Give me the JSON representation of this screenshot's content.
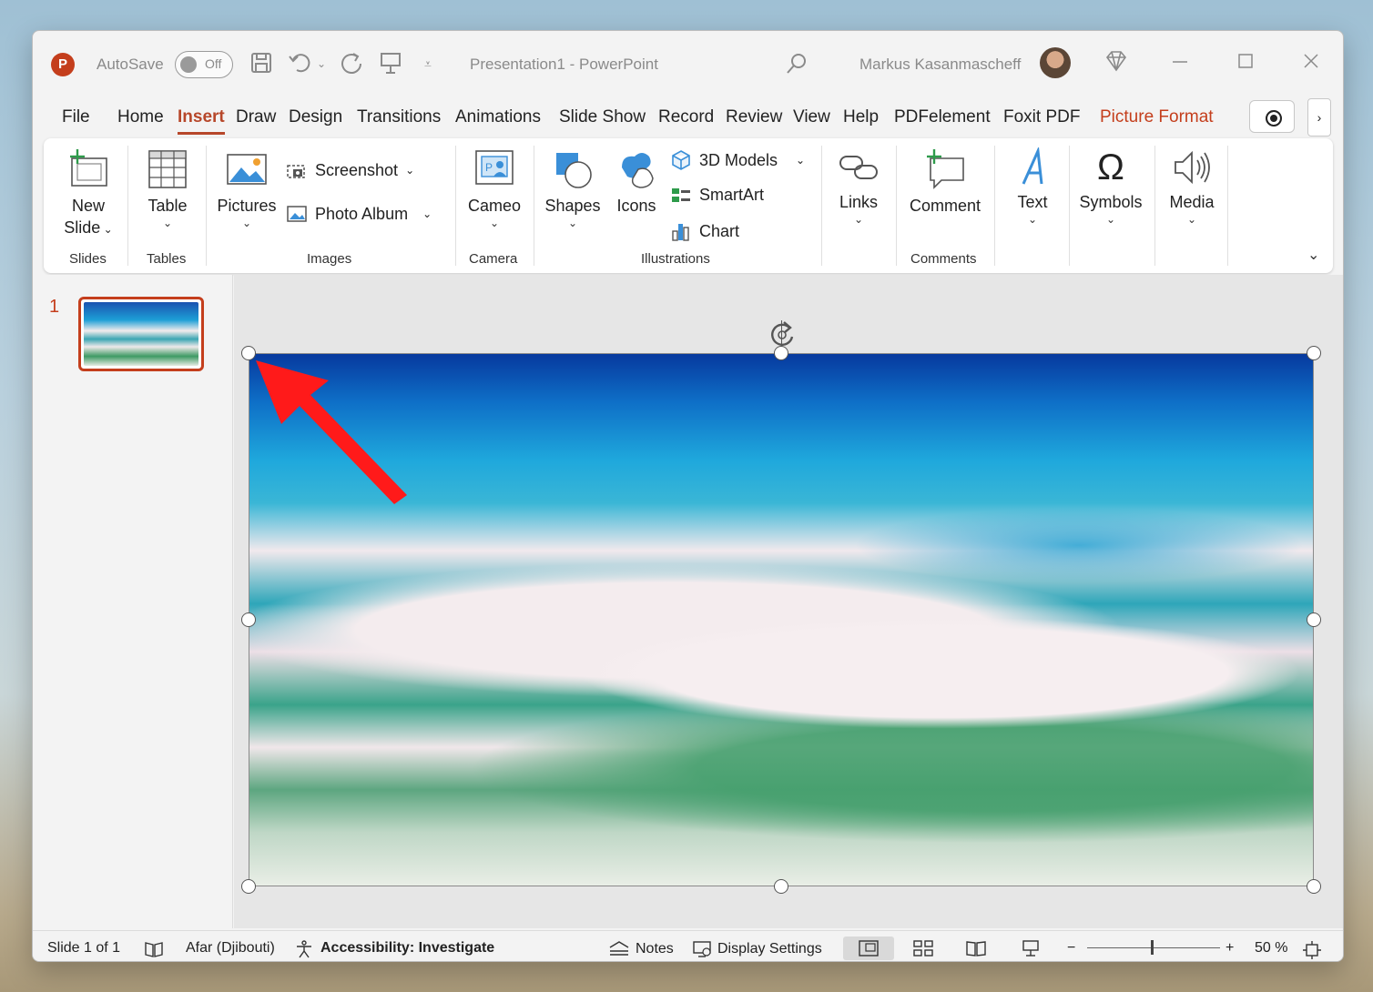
{
  "titlebar": {
    "app_letter": "P",
    "autosave_label": "AutoSave",
    "autosave_state": "Off",
    "doc_title": "Presentation1  -  PowerPoint",
    "user_name": "Markus Kasanmascheff"
  },
  "tabs": [
    "File",
    "Home",
    "Insert",
    "Draw",
    "Design",
    "Transitions",
    "Animations",
    "Slide Show",
    "Record",
    "Review",
    "View",
    "Help",
    "PDFelement",
    "Foxit PDF",
    "Picture Format"
  ],
  "active_tab": "Insert",
  "ribbon": {
    "new_slide": [
      "New",
      "Slide"
    ],
    "table": "Table",
    "pictures": "Pictures",
    "screenshot": "Screenshot",
    "photo_album": "Photo Album",
    "cameo": "Cameo",
    "shapes": "Shapes",
    "icons": "Icons",
    "models_3d": "3D Models",
    "smartart": "SmartArt",
    "chart": "Chart",
    "links": "Links",
    "comment": "Comment",
    "text": "Text",
    "symbols": "Symbols",
    "media": "Media",
    "groups": {
      "slides": "Slides",
      "tables": "Tables",
      "images": "Images",
      "camera": "Camera",
      "illustrations": "Illustrations",
      "comments": "Comments"
    }
  },
  "thumbnails": {
    "slide_number": "1"
  },
  "status": {
    "slide_info": "Slide 1 of 1",
    "language": "Afar (Djibouti)",
    "accessibility": "Accessibility: Investigate",
    "notes": "Notes",
    "display_settings": "Display Settings",
    "zoom_minus": "−",
    "zoom_plus": "+",
    "zoom": "50 %"
  },
  "colors": {
    "accent": "#c43e1c",
    "active_tab": "#b7472a",
    "annotation_arrow": "#ff1a1a"
  }
}
